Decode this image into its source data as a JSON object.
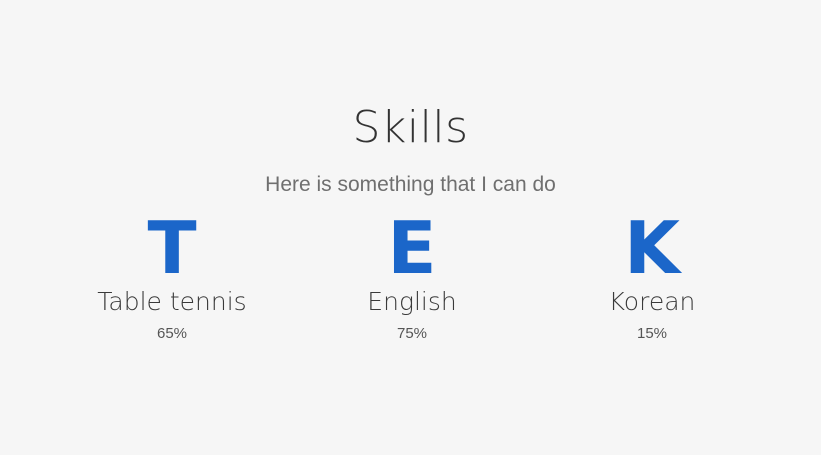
{
  "skills_section": {
    "title": "Skills",
    "subtitle": "Here is something that I can do",
    "accent_color": "#1b66c9",
    "items": [
      {
        "letter": "T",
        "name": "Table tennis",
        "percent": "65%",
        "level": 0.65
      },
      {
        "letter": "E",
        "name": "English",
        "percent": "75%",
        "level": 0.75
      },
      {
        "letter": "K",
        "name": "Korean",
        "percent": "15%",
        "level": 0.15
      }
    ]
  }
}
